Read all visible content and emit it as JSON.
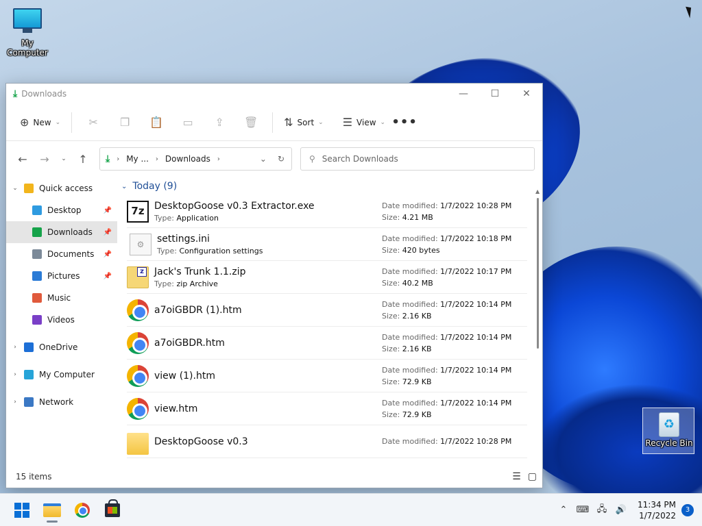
{
  "desktop": {
    "icons": {
      "my_computer": "My Computer",
      "recycle_bin": "Recycle Bin"
    }
  },
  "window": {
    "title": "Downloads",
    "controls": [
      "minimize",
      "maximize",
      "close"
    ]
  },
  "toolbar": {
    "new_label": "New",
    "sort_label": "Sort",
    "view_label": "View",
    "more_label": "•••"
  },
  "address": {
    "segments": [
      "My ...",
      "Downloads"
    ],
    "search_placeholder": "Search Downloads"
  },
  "sidebar": {
    "items": [
      {
        "label": "Quick access",
        "caret": "expanded",
        "icon": "star-icon",
        "color": "#f2b51c"
      },
      {
        "label": "Desktop",
        "pinned": true,
        "icon": "desktop-icon",
        "color": "#2f9be0"
      },
      {
        "label": "Downloads",
        "pinned": true,
        "selected": true,
        "icon": "download-icon",
        "color": "#16a34a"
      },
      {
        "label": "Documents",
        "pinned": true,
        "icon": "documents-icon",
        "color": "#7c8a99"
      },
      {
        "label": "Pictures",
        "pinned": true,
        "icon": "pictures-icon",
        "color": "#2b7bd6"
      },
      {
        "label": "Music",
        "icon": "music-icon",
        "color": "#e05a3c"
      },
      {
        "label": "Videos",
        "icon": "videos-icon",
        "color": "#7a3fc7"
      },
      {
        "label": "OneDrive",
        "caret": "collapsed",
        "icon": "onedrive-icon",
        "color": "#1d6fd6"
      },
      {
        "label": "My Computer",
        "caret": "collapsed",
        "icon": "computer-icon",
        "color": "#27a4d8"
      },
      {
        "label": "Network",
        "caret": "collapsed",
        "icon": "network-icon",
        "color": "#3b78c4"
      }
    ]
  },
  "content": {
    "group_label": "Today (9)",
    "labels": {
      "date_modified": "Date modified:",
      "type": "Type:",
      "size": "Size:"
    },
    "files": [
      {
        "name": "DesktopGoose v0.3 Extractor.exe",
        "type": "Application",
        "date": "1/7/2022 10:28 PM",
        "size": "4.21 MB",
        "icon": "7zip-icon"
      },
      {
        "name": "settings.ini",
        "type": "Configuration settings",
        "date": "1/7/2022 10:18 PM",
        "size": "420 bytes",
        "icon": "settings-file-icon"
      },
      {
        "name": "Jack's Trunk 1.1.zip",
        "type": "zip Archive",
        "date": "1/7/2022 10:17 PM",
        "size": "40.2 MB",
        "icon": "zip-icon"
      },
      {
        "name": "a7oiGBDR (1).htm",
        "type": "",
        "date": "1/7/2022 10:14 PM",
        "size": "2.16 KB",
        "icon": "chrome-icon"
      },
      {
        "name": "a7oiGBDR.htm",
        "type": "",
        "date": "1/7/2022 10:14 PM",
        "size": "2.16 KB",
        "icon": "chrome-icon"
      },
      {
        "name": "view (1).htm",
        "type": "",
        "date": "1/7/2022 10:14 PM",
        "size": "72.9 KB",
        "icon": "chrome-icon"
      },
      {
        "name": "view.htm",
        "type": "",
        "date": "1/7/2022 10:14 PM",
        "size": "72.9 KB",
        "icon": "chrome-icon"
      },
      {
        "name": "DesktopGoose v0.3",
        "type": "",
        "date": "1/7/2022 10:28 PM",
        "size": "",
        "icon": "folder-icon"
      }
    ]
  },
  "status": {
    "items_count": "15 items"
  },
  "taskbar": {
    "time": "11:34 PM",
    "date": "1/7/2022",
    "notification_count": "3"
  }
}
